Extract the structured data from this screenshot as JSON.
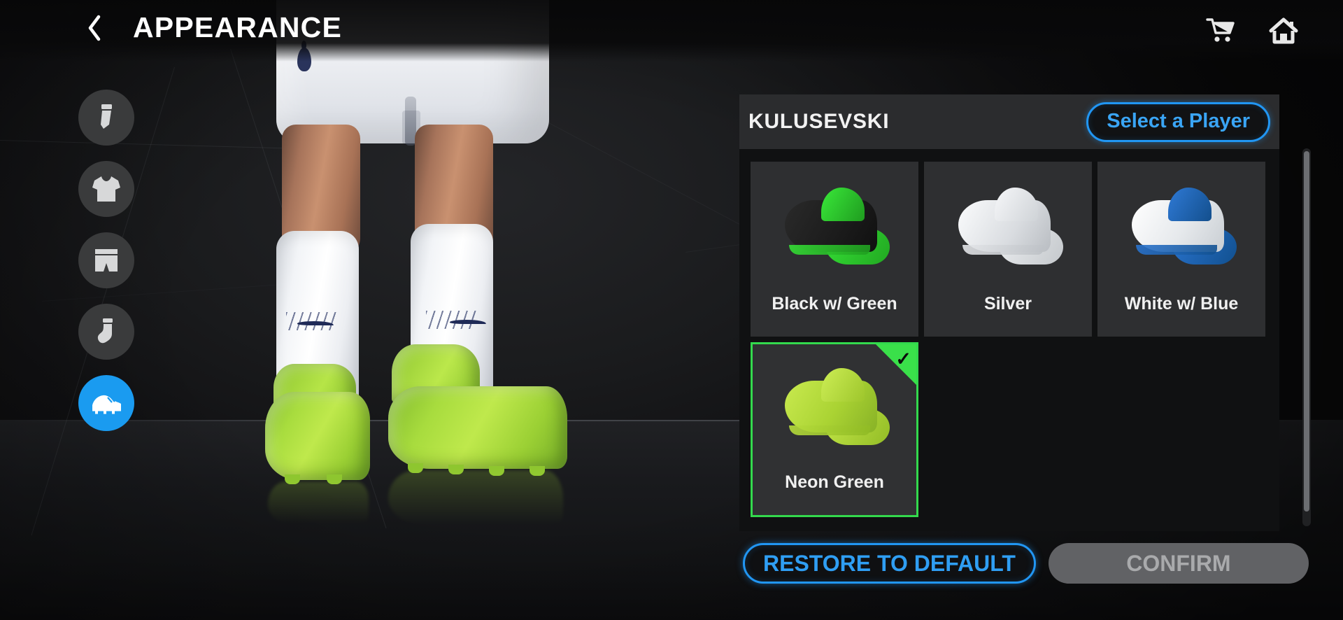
{
  "header": {
    "title": "APPEARANCE",
    "back_icon": "chevron-left-icon",
    "cart_icon": "shopping-cart-icon",
    "home_icon": "home-icon"
  },
  "sidebar": {
    "items": [
      {
        "name": "sleeve",
        "icon": "arm-sleeve-icon",
        "selected": false
      },
      {
        "name": "shirt",
        "icon": "shirt-icon",
        "selected": false
      },
      {
        "name": "shorts",
        "icon": "shorts-icon",
        "selected": false
      },
      {
        "name": "socks",
        "icon": "sock-icon",
        "selected": false
      },
      {
        "name": "boots",
        "icon": "boot-icon",
        "selected": true
      }
    ]
  },
  "panel": {
    "player_name": "KULUSEVSKI",
    "select_player_label": "Select a Player",
    "items": [
      {
        "label": "Black w/ Green",
        "selected": false,
        "boot_main": "#1d1d1d",
        "boot_accent": "#2ecc2e",
        "boot_collar": "#2ecc2e",
        "boot_second": "#2ecc2e"
      },
      {
        "label": "Silver",
        "selected": false,
        "boot_main": "#e6e8ea",
        "boot_accent": "#cfd2d6",
        "boot_collar": "#f2f4f6",
        "boot_second": "#dcdfe3"
      },
      {
        "label": "White w/ Blue",
        "selected": false,
        "boot_main": "#f3f5f7",
        "boot_accent": "#1558b0",
        "boot_collar": "#1f66c4",
        "boot_second": "#1f66c4"
      },
      {
        "label": "Neon Green",
        "selected": true,
        "boot_main": "#b4dd34",
        "boot_accent": "#a4cd2c",
        "boot_collar": "#bde23e",
        "boot_second": "#aed431"
      }
    ],
    "selected_badge_icon": "check-icon"
  },
  "actions": {
    "restore_label": "RESTORE TO DEFAULT",
    "confirm_label": "CONFIRM"
  },
  "colors": {
    "accent_blue": "#2196f3",
    "selected_green": "#33d94d",
    "badge_green": "#3ae04a",
    "panel_bg": "#101112",
    "card_bg": "#2e2f31",
    "header_bg": "#2b2c2e",
    "confirm_disabled": "#616265"
  },
  "scrollbar": {
    "name": "vertical-scrollbar"
  }
}
